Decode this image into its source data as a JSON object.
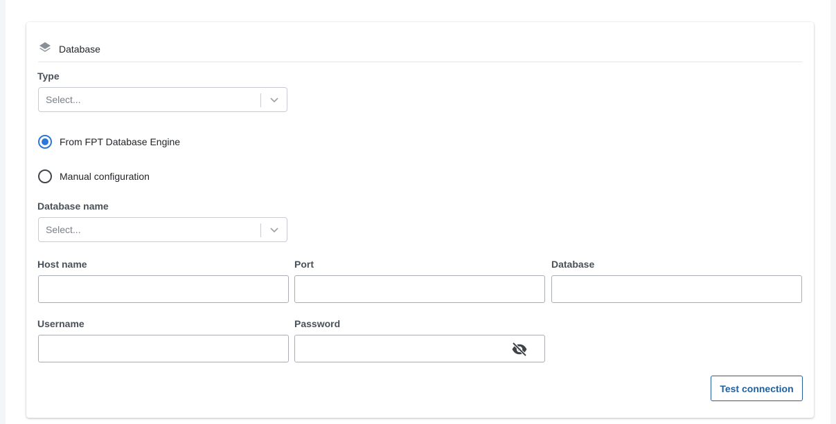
{
  "section": {
    "title": "Database",
    "icon": "layers-icon"
  },
  "type_field": {
    "label": "Type",
    "placeholder": "Select..."
  },
  "source_options": [
    {
      "label": "From FPT Database Engine",
      "checked": true
    },
    {
      "label": "Manual configuration",
      "checked": false
    }
  ],
  "database_name_field": {
    "label": "Database name",
    "placeholder": "Select..."
  },
  "host_name_field": {
    "label": "Host name",
    "value": ""
  },
  "port_field": {
    "label": "Port",
    "value": ""
  },
  "database_field": {
    "label": "Database",
    "value": ""
  },
  "username_field": {
    "label": "Username",
    "value": ""
  },
  "password_field": {
    "label": "Password",
    "value": "",
    "toggle_icon": "eye-off-icon"
  },
  "actions": {
    "test_connection_label": "Test connection"
  },
  "colors": {
    "accent": "#2b78d6",
    "button": "#1f5f9e"
  }
}
